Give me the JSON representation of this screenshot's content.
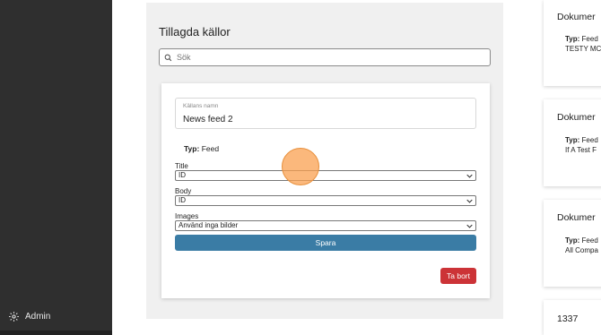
{
  "sidebar": {
    "admin_label": "Admin"
  },
  "panel": {
    "title": "Tillagda källor",
    "search_placeholder": "Sök"
  },
  "source_card": {
    "name_label": "Källans namn",
    "name_value": "News feed 2",
    "type_label": "Typ:",
    "type_value": "Feed",
    "fields": [
      {
        "label": "Title",
        "value": "ID"
      },
      {
        "label": "Body",
        "value": "ID"
      },
      {
        "label": "Images",
        "value": "Använd inga bilder"
      }
    ],
    "save_label": "Spara",
    "delete_label": "Ta bort"
  },
  "right_cards": [
    {
      "title": "Dokumer",
      "type_label": "Typ:",
      "type_value": "Feed",
      "desc": "TESTY MC"
    },
    {
      "title": "Dokumer",
      "type_label": "Typ:",
      "type_value": "Feed",
      "desc": "If A Test F"
    },
    {
      "title": "Dokumer",
      "type_label": "Typ:",
      "type_value": "Feed",
      "desc": "All Compa"
    },
    {
      "title": "1337"
    }
  ],
  "colors": {
    "sidebar": "#2f2f2f",
    "save_button": "#3a7ca5",
    "delete_button": "#cc3337",
    "cursor": "#f9a050"
  }
}
